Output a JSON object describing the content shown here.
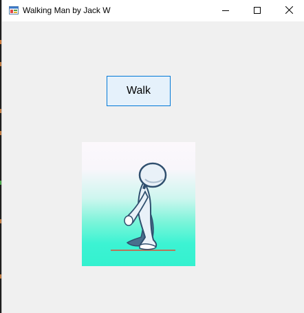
{
  "window": {
    "title": "Walking Man by Jack W",
    "icon": "app-window-icon",
    "controls": [
      "minimize-icon",
      "maximize-icon",
      "close-icon"
    ]
  },
  "form": {
    "walk_button_label": "Walk",
    "picture": "walking-man-figure"
  },
  "colors": {
    "title_bar": "#ffffff",
    "form_background": "#f0f0f0",
    "button_background": "#e5f1fb",
    "button_border": "#0078d7",
    "figure_stroke": "#2f4f6e",
    "figure_fill": "#e9f1f8",
    "scene_bottom": "#34f1cf",
    "ground_line": "#b8765a"
  }
}
